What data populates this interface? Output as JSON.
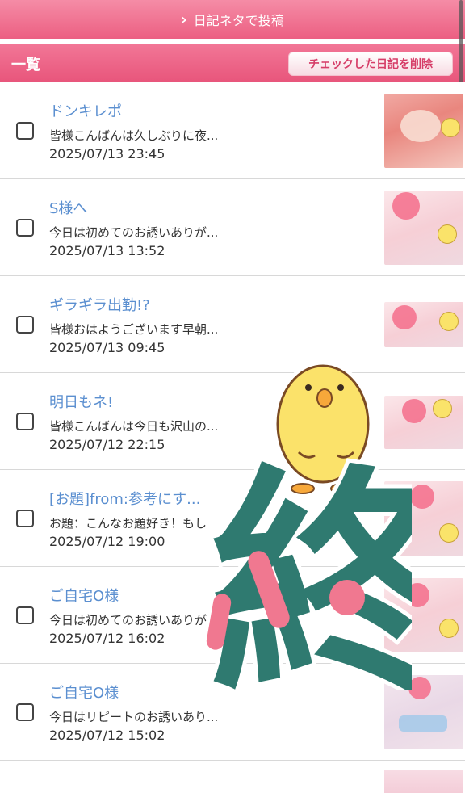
{
  "top_bar": {
    "label": "日記ネタで投稿"
  },
  "list_header": {
    "title": "一覧",
    "delete_label": "チェックした日記を削除"
  },
  "entries": [
    {
      "title": "ドンキレポ",
      "snippet": "皆様こんばんは久しぶりに夜...",
      "date": "2025/07/13 23:45"
    },
    {
      "title": "S様へ",
      "snippet": "今日は初めてのお誘いありが...",
      "date": "2025/07/13 13:52"
    },
    {
      "title": "ギラギラ出勤!?",
      "snippet": "皆様おはようございます早朝...",
      "date": "2025/07/13 09:45"
    },
    {
      "title": "明日もネ!",
      "snippet": "皆様こんばんは今日も沢山の...",
      "date": "2025/07/12 22:15"
    },
    {
      "title": "[お題]from:参考にす...",
      "snippet": "お題：こんなお題好き！もし",
      "date": "2025/07/12 19:00"
    },
    {
      "title": "ご自宅O様",
      "snippet": "今日は初めてのお誘いありが",
      "date": "2025/07/12 16:02"
    },
    {
      "title": "ご自宅O様",
      "snippet": "今日はリピートのお誘いあり...",
      "date": "2025/07/12 15:02"
    }
  ],
  "sticker": {
    "text": "終"
  },
  "colors": {
    "accent": "#ec5f82",
    "link": "#5b8fd0",
    "sticker": "#2f7a70"
  },
  "icons": [
    "chevron-right-icon",
    "checkbox-icon",
    "chick-icon"
  ]
}
